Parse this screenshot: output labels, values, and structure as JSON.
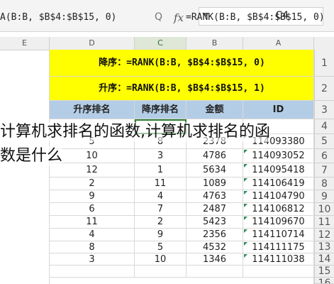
{
  "formula_bar": {
    "left_fragment": "A(B:B, $B$4:$B$15, 0)",
    "formula": "=RANK(B:B, $B$4:$B$15, 0)",
    "fx_label": "fx",
    "zoom_glyph": "Q",
    "name_box": "C4"
  },
  "columns": [
    "E",
    "D",
    "C",
    "B",
    "A"
  ],
  "rows": [
    "1",
    "2",
    "3",
    "4",
    "5",
    "6",
    "7",
    "8",
    "9",
    "10",
    "11",
    "12",
    "13",
    "14",
    "15",
    "16"
  ],
  "banner": {
    "line1": "降序：=RANK(B:B, $B$4:$B$15, 0)",
    "line2": "升序：=RANK(B:B, $B$4:$B$15, 1)"
  },
  "table_header": {
    "asc": "升序排名",
    "desc": "降序排名",
    "amount": "金额",
    "id": "ID"
  },
  "table_rows": [
    {
      "id": "",
      "amount": "",
      "desc": "",
      "asc": ""
    },
    {
      "id": "114093380",
      "amount": "2378",
      "desc": "8",
      "asc": "5"
    },
    {
      "id": "114093052",
      "amount": "4786",
      "desc": "3",
      "asc": "10"
    },
    {
      "id": "114095418",
      "amount": "5634",
      "desc": "1",
      "asc": "12"
    },
    {
      "id": "114106419",
      "amount": "1089",
      "desc": "11",
      "asc": "2"
    },
    {
      "id": "114104790",
      "amount": "4763",
      "desc": "4",
      "asc": "9"
    },
    {
      "id": "114106812",
      "amount": "2487",
      "desc": "7",
      "asc": "6"
    },
    {
      "id": "114109670",
      "amount": "5423",
      "desc": "2",
      "asc": "11"
    },
    {
      "id": "114110714",
      "amount": "2356",
      "desc": "9",
      "asc": "4"
    },
    {
      "id": "114111175",
      "amount": "4532",
      "desc": "5",
      "asc": "8"
    },
    {
      "id": "114111038",
      "amount": "1346",
      "desc": "10",
      "asc": "3"
    },
    {
      "id": "",
      "amount": "",
      "desc": "",
      "asc": ""
    }
  ],
  "overlay": {
    "line1": "计算机求排名的函数,计算机求排名的函",
    "line2": "数是什么"
  },
  "colors": {
    "yellow": "#ffff00",
    "header_blue": "#b4cde6",
    "corner_mark": "#2e8b57"
  }
}
